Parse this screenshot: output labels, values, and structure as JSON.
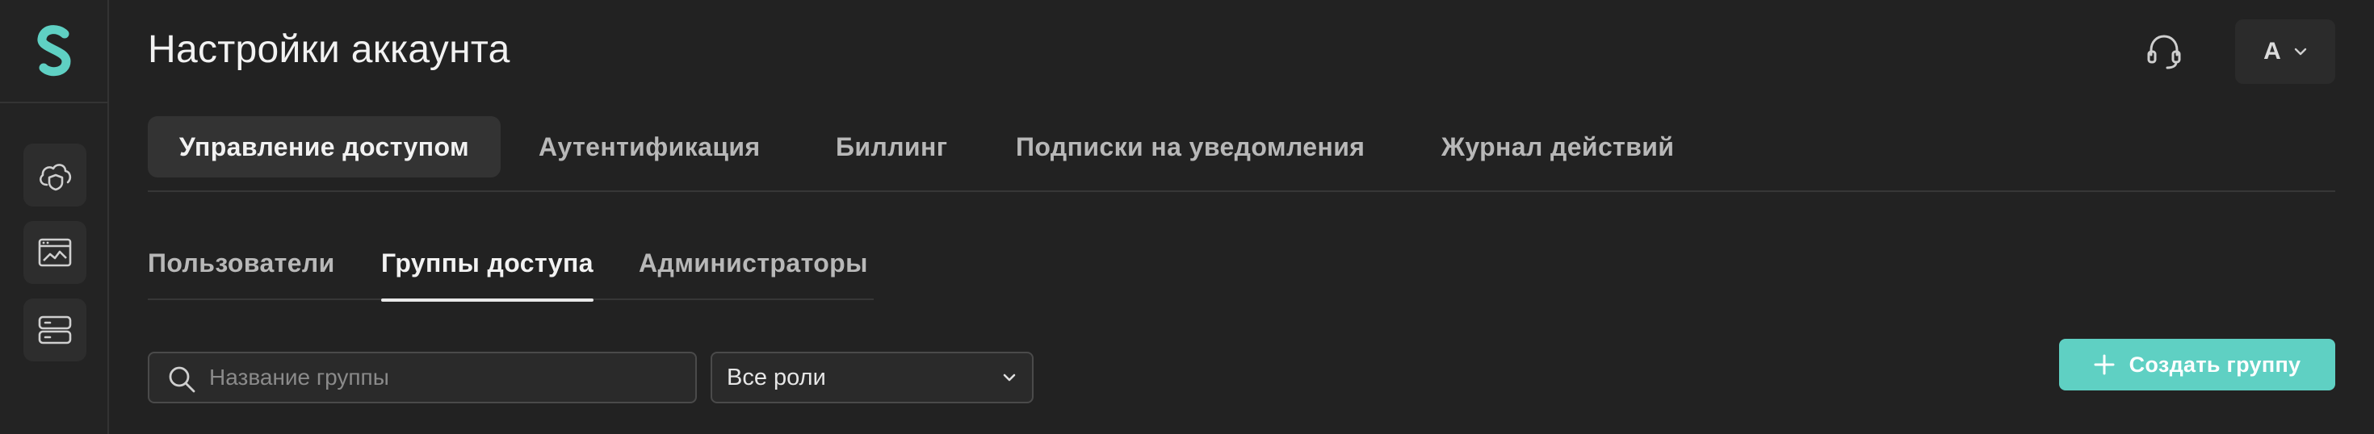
{
  "app": {
    "title": "Настройки аккаунта",
    "accent_color": "#5fd0c3",
    "logo_icon": "brand-logo-icon"
  },
  "sidebar": {
    "items": [
      {
        "icon": "cloud-shield-icon"
      },
      {
        "icon": "browser-chart-icon"
      },
      {
        "icon": "server-icon"
      }
    ]
  },
  "header": {
    "support_icon": "headset-icon",
    "user_initial": "А",
    "user_menu_icon": "chevron-down-icon"
  },
  "main_tabs": [
    {
      "label": "Управление доступом",
      "active": true
    },
    {
      "label": "Аутентификация",
      "active": false
    },
    {
      "label": "Биллинг",
      "active": false
    },
    {
      "label": "Подписки на уведомления",
      "active": false
    },
    {
      "label": "Журнал действий",
      "active": false
    }
  ],
  "sub_tabs": [
    {
      "label": "Пользователи",
      "active": false
    },
    {
      "label": "Группы доступа",
      "active": true
    },
    {
      "label": "Администраторы",
      "active": false
    }
  ],
  "filters": {
    "search_placeholder": "Название группы",
    "search_value": "",
    "role_selected": "Все роли"
  },
  "actions": {
    "create_group": "Создать группу"
  }
}
